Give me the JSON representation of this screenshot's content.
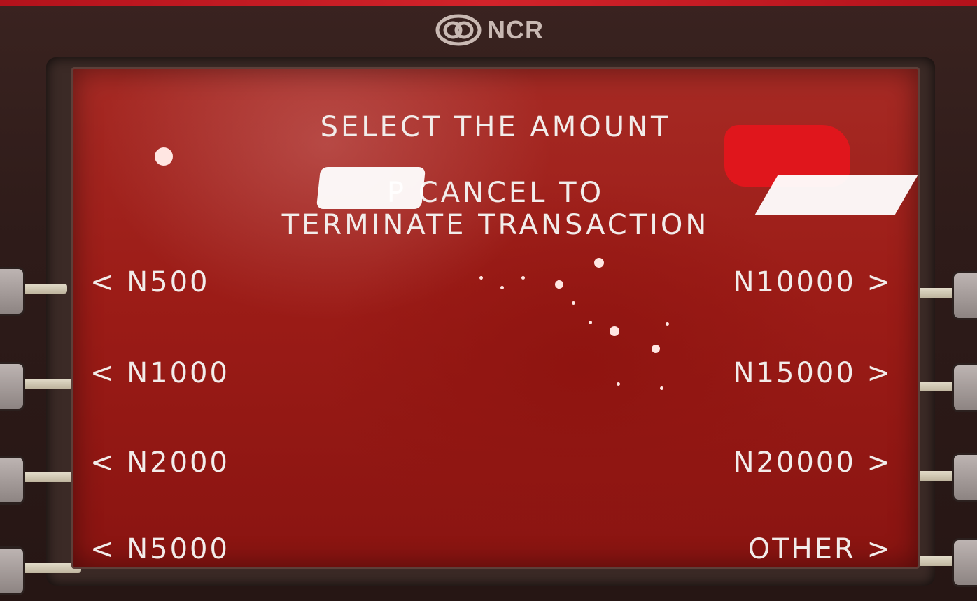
{
  "brand": {
    "logo_text": "NCR",
    "logo_icon": "ncr-logo-icon"
  },
  "screen": {
    "heading": "SELECT THE AMOUNT",
    "instruction_line1": "P          CANCEL TO",
    "instruction_line2": "TERMINATE TRANSACTION",
    "left_options": [
      {
        "label": "< N500"
      },
      {
        "label": "< N1000"
      },
      {
        "label": "< N2000"
      },
      {
        "label": "< N5000"
      }
    ],
    "right_options": [
      {
        "label": "N10000 >"
      },
      {
        "label": "N15000 >"
      },
      {
        "label": "N20000 >"
      },
      {
        "label": "OTHER >"
      }
    ]
  },
  "colors": {
    "screen_red": "#9c1c17",
    "text": "#f2ecea",
    "redaction": "#e0161c",
    "top_strip": "#d2232a"
  }
}
